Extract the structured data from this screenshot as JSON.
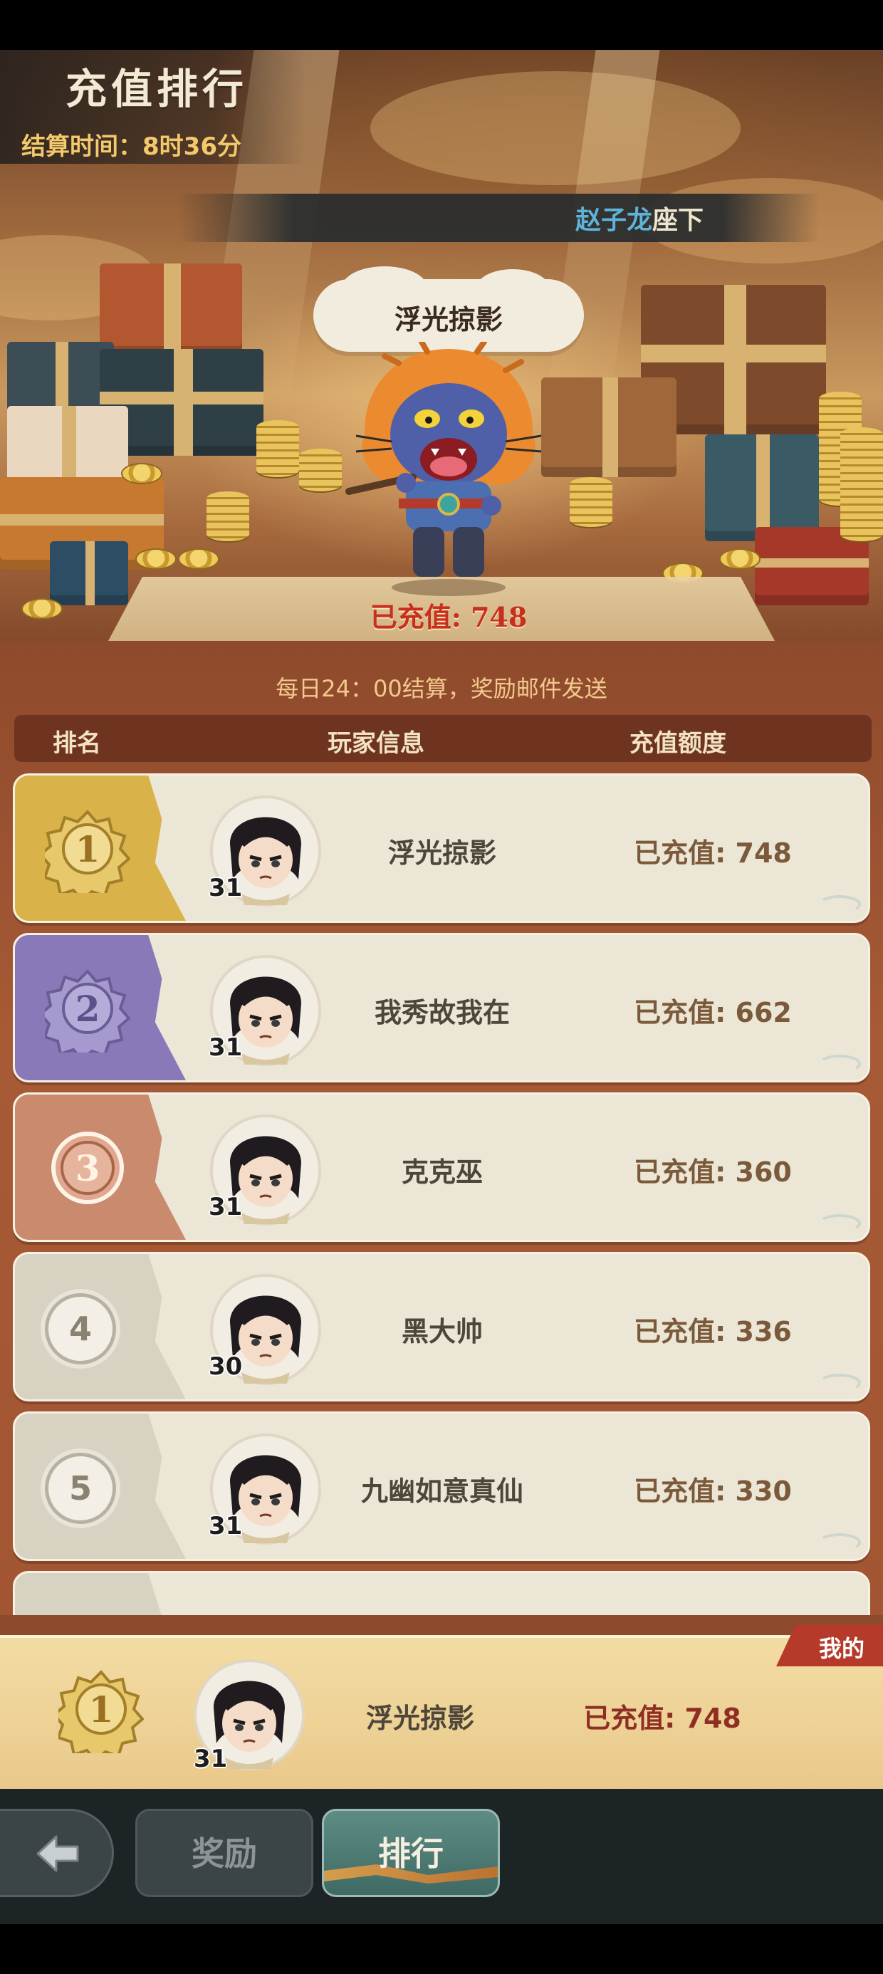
{
  "header": {
    "title": "充值排行",
    "settle_time": "结算时间：8时36分"
  },
  "sponsor": {
    "name": "赵子龙",
    "suffix": "座下"
  },
  "top_player": {
    "name": "浮光掠影",
    "topup": "已充值: 748"
  },
  "daily_note": "每日24：00结算，奖励邮件发送",
  "columns": {
    "rank": "排名",
    "player": "玩家信息",
    "amount": "充值额度"
  },
  "rows": [
    {
      "rank": "1",
      "level": "31",
      "name": "浮光掠影",
      "topup": "已充值: 748"
    },
    {
      "rank": "2",
      "level": "31",
      "name": "我秀故我在",
      "topup": "已充值: 662"
    },
    {
      "rank": "3",
      "level": "31",
      "name": "克克巫",
      "topup": "已充值: 360"
    },
    {
      "rank": "4",
      "level": "30",
      "name": "黑大帅",
      "topup": "已充值: 336"
    },
    {
      "rank": "5",
      "level": "31",
      "name": "九幽如意真仙",
      "topup": "已充值: 330"
    }
  ],
  "mine": {
    "tag": "我的",
    "rank": "1",
    "level": "31",
    "name": "浮光掠影",
    "topup": "已充值: 748"
  },
  "nav": {
    "back_icon": "arrow-left-icon",
    "reward_label": "奖励",
    "rank_label": "排行"
  },
  "colors": {
    "gold": "#d9b24a",
    "silver_purple": "#8a79b8",
    "bronze": "#c98a6e",
    "plain": "#d8d2c2",
    "accent_red": "#c72f1f"
  }
}
